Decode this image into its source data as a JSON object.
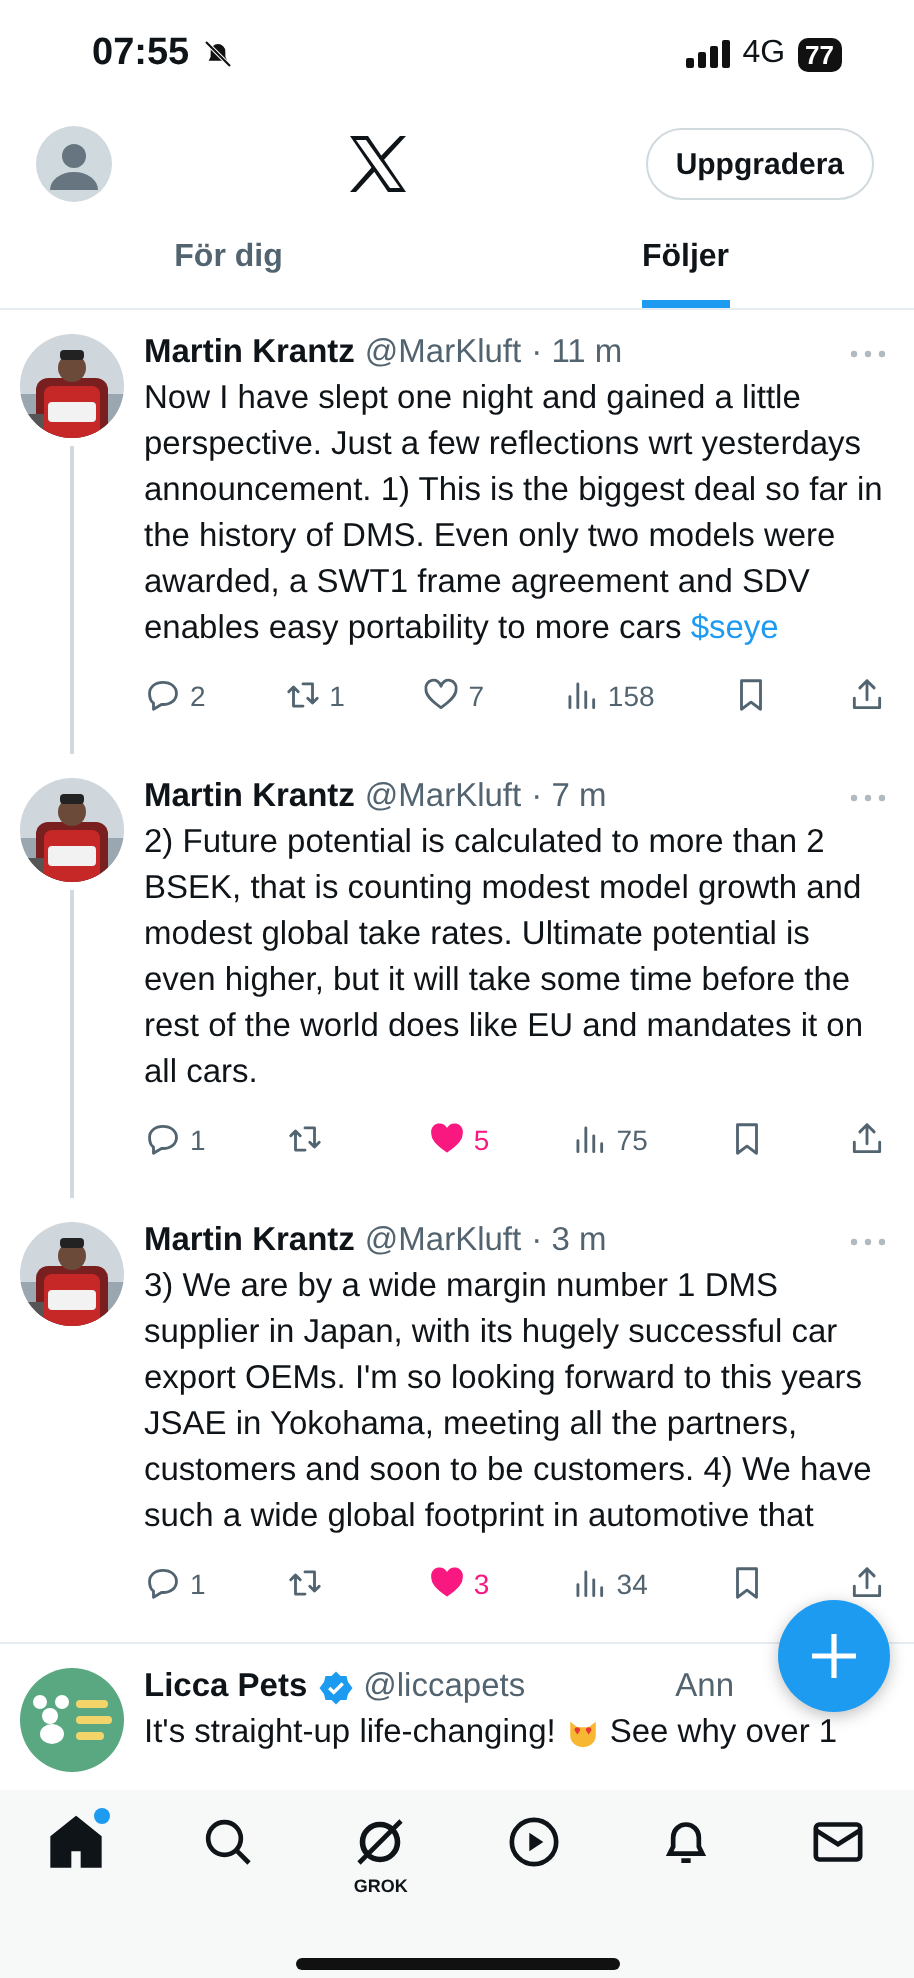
{
  "status_bar": {
    "time": "07:55",
    "network": "4G",
    "battery": "77"
  },
  "header": {
    "upgrade_button": "Uppgradera"
  },
  "tabs": [
    {
      "label": "För dig",
      "selected": false
    },
    {
      "label": "Följer",
      "selected": true
    }
  ],
  "tweets": [
    {
      "name": "Martin Krantz",
      "handle": "@MarKluft",
      "time": "· 11 m",
      "text": "Now I have slept one night and gained a little perspective. Just a few reflections wrt yesterdays announcement. 1) This is the biggest deal so far in the history of DMS. Even only two models were awarded, a SWT1 frame agreement and SDV enables easy portability to more cars",
      "cashtag": "$seye",
      "replies": "2",
      "reposts": "1",
      "likes": "7",
      "liked": false,
      "views": "158"
    },
    {
      "name": "Martin Krantz",
      "handle": "@MarKluft",
      "time": "· 7 m",
      "text": "2) Future potential is calculated to more than 2 BSEK, that is counting modest model growth and modest global take rates. Ultimate potential is even higher, but it will take some time before the rest of the world does like EU and mandates it on all cars.",
      "replies": "1",
      "likes": "5",
      "liked": true,
      "views": "75"
    },
    {
      "name": "Martin Krantz",
      "handle": "@MarKluft",
      "time": "· 3 m",
      "text": "3)  We are by a wide margin number 1 DMS supplier in Japan, with its hugely successful car export OEMs. I'm so looking forward to this years JSAE in Yokohama, meeting all the partners, customers and soon to be customers.  4) We have such a wide global footprint in automotive that",
      "replies": "1",
      "likes": "3",
      "liked": true,
      "views": "34"
    }
  ],
  "promoted": {
    "name": "Licca Pets",
    "verified": true,
    "handle": "@liccapets",
    "label": "Ann",
    "text": "It's straight-up life-changing!",
    "text_after": "See why over 1"
  },
  "nav": [
    {
      "kind": "home",
      "selected": true,
      "badge": true
    },
    {
      "kind": "search",
      "selected": false,
      "badge": false
    },
    {
      "kind": "grok",
      "selected": false,
      "badge": false,
      "label": "GROK"
    },
    {
      "kind": "video",
      "selected": false,
      "badge": false
    },
    {
      "kind": "bell",
      "selected": false,
      "badge": false
    },
    {
      "kind": "mail",
      "selected": false,
      "badge": false
    }
  ]
}
